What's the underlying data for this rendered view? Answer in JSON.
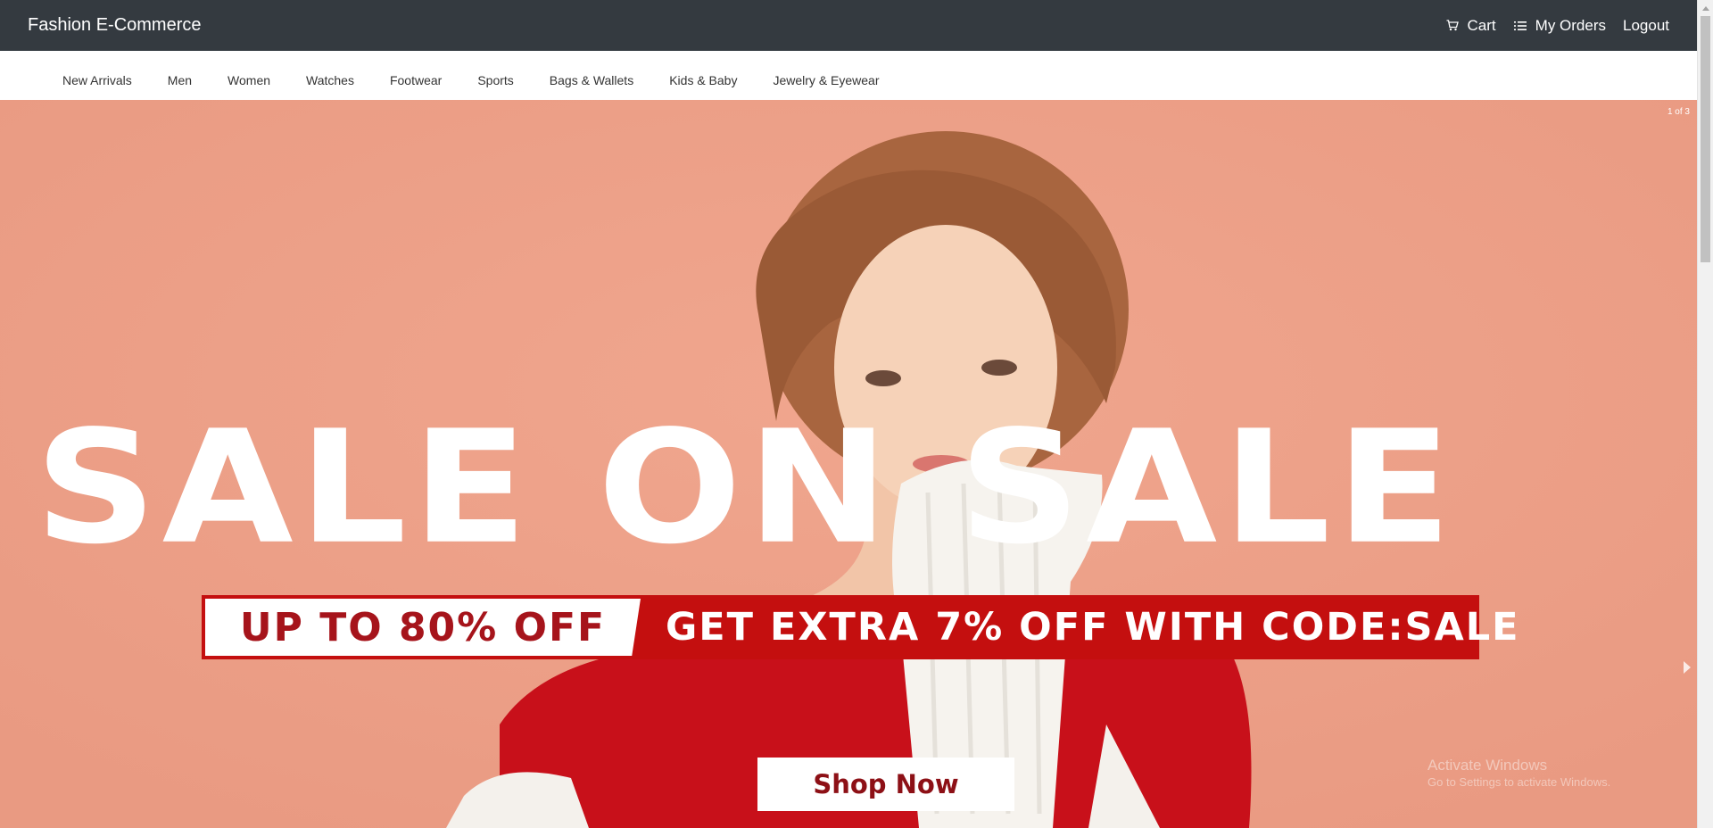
{
  "header": {
    "brand": "Fashion E-Commerce",
    "nav": [
      {
        "label": "Cart",
        "icon": "cart-icon"
      },
      {
        "label": "My Orders",
        "icon": "list-icon"
      },
      {
        "label": "Logout"
      }
    ]
  },
  "categories": [
    "New Arrivals",
    "Men",
    "Women",
    "Watches",
    "Footwear",
    "Sports",
    "Bags & Wallets",
    "Kids & Baby",
    "Jewelry & Eyewear"
  ],
  "hero": {
    "slide_counter": "1 of 3",
    "headline": "SALE ON SALE",
    "promo_left": "UP TO 80% OFF",
    "promo_right": "GET EXTRA 7% OFF WITH CODE:SALE",
    "button": "Shop Now",
    "watermark_title": "Activate Windows",
    "watermark_sub": "Go to Settings to activate Windows."
  },
  "colors": {
    "navbar": "#343a40",
    "hero_bg": "#eea28a",
    "promo_red": "#c40f0f",
    "promo_text_dark": "#a6141b"
  }
}
